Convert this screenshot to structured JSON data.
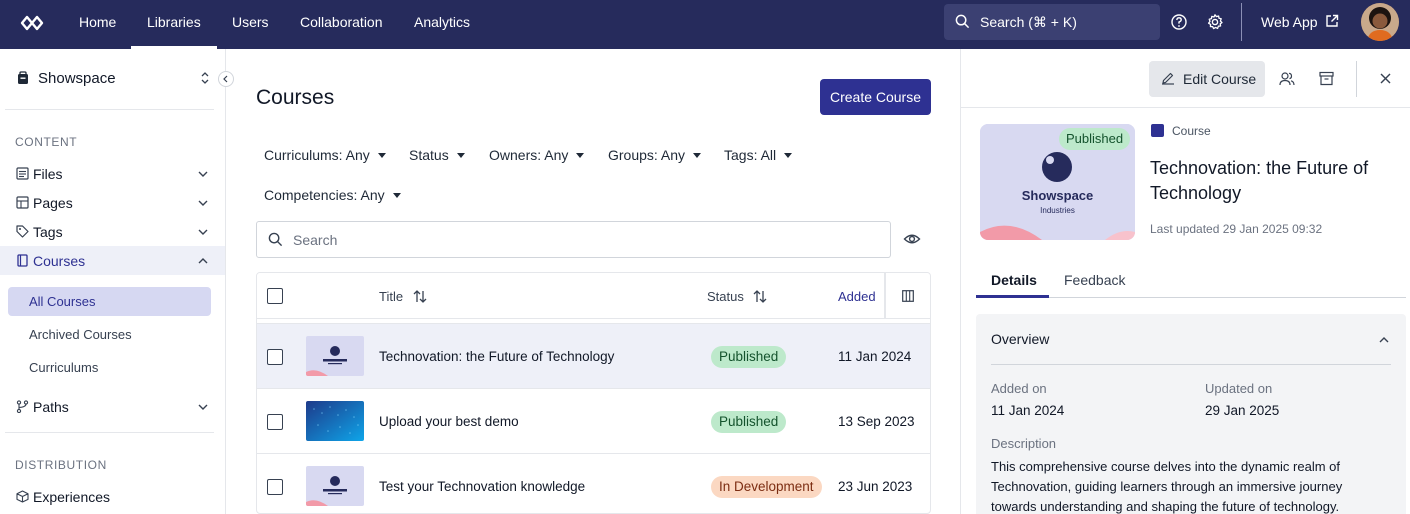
{
  "nav": {
    "links": [
      "Home",
      "Libraries",
      "Users",
      "Collaboration",
      "Analytics"
    ],
    "active": "Libraries",
    "search_label": "Search (⌘ + K)",
    "webapp_label": "Web App"
  },
  "sidebar": {
    "workspace": "Showspace",
    "section_content": "CONTENT",
    "items": [
      {
        "label": "Files",
        "icon": "files-icon",
        "expanded": false
      },
      {
        "label": "Pages",
        "icon": "pages-icon",
        "expanded": false
      },
      {
        "label": "Tags",
        "icon": "tag-icon",
        "expanded": false
      },
      {
        "label": "Courses",
        "icon": "book-icon",
        "expanded": true
      },
      {
        "label": "Paths",
        "icon": "paths-icon",
        "expanded": false
      }
    ],
    "course_subitems": [
      "All Courses",
      "Archived Courses",
      "Curriculums"
    ],
    "active_subitem": "All Courses",
    "section_distribution": "DISTRIBUTION",
    "dist_items": [
      {
        "label": "Experiences",
        "icon": "cube-icon"
      }
    ]
  },
  "main": {
    "title": "Courses",
    "create_label": "Create Course",
    "filters": [
      "Curriculums: Any",
      "Status",
      "Owners: Any",
      "Groups: Any",
      "Tags: All",
      "Competencies: Any"
    ],
    "search_placeholder": "Search",
    "columns": {
      "title": "Title",
      "status": "Status",
      "added": "Added"
    },
    "rows": [
      {
        "title": "Technovation: the Future of Technology",
        "status": "Published",
        "status_type": "published",
        "added": "11 Jan 2024",
        "thumb": "showspace",
        "selected": true
      },
      {
        "title": "Upload your best demo",
        "status": "Published",
        "status_type": "published",
        "added": "13 Sep 2023",
        "thumb": "blue",
        "selected": false
      },
      {
        "title": "Test your Technovation knowledge",
        "status": "In Development",
        "status_type": "development",
        "added": "23 Jun 2023",
        "thumb": "showspace",
        "selected": false
      }
    ]
  },
  "panel": {
    "edit_label": "Edit Course",
    "cover_status": "Published",
    "cover_brand": "Showspace",
    "cover_sub": "Industries",
    "type_label": "Course",
    "course_title": "Technovation: the Future of Technology",
    "last_updated": "Last updated 29 Jan 2025 09:32",
    "tabs": [
      "Details",
      "Feedback"
    ],
    "active_tab": "Details",
    "overview_title": "Overview",
    "added_on_label": "Added on",
    "added_on": "11 Jan 2024",
    "updated_on_label": "Updated on",
    "updated_on": "29 Jan 2025",
    "description_label": "Description",
    "description": "This comprehensive course delves into the dynamic realm of Technovation, guiding learners through an immersive journey towards understanding and shaping the future of technology."
  },
  "colors": {
    "nav_bg": "#262b5c",
    "accent": "#2e3192",
    "published_bg": "#bde9cb",
    "development_bg": "#fbd8c2"
  }
}
